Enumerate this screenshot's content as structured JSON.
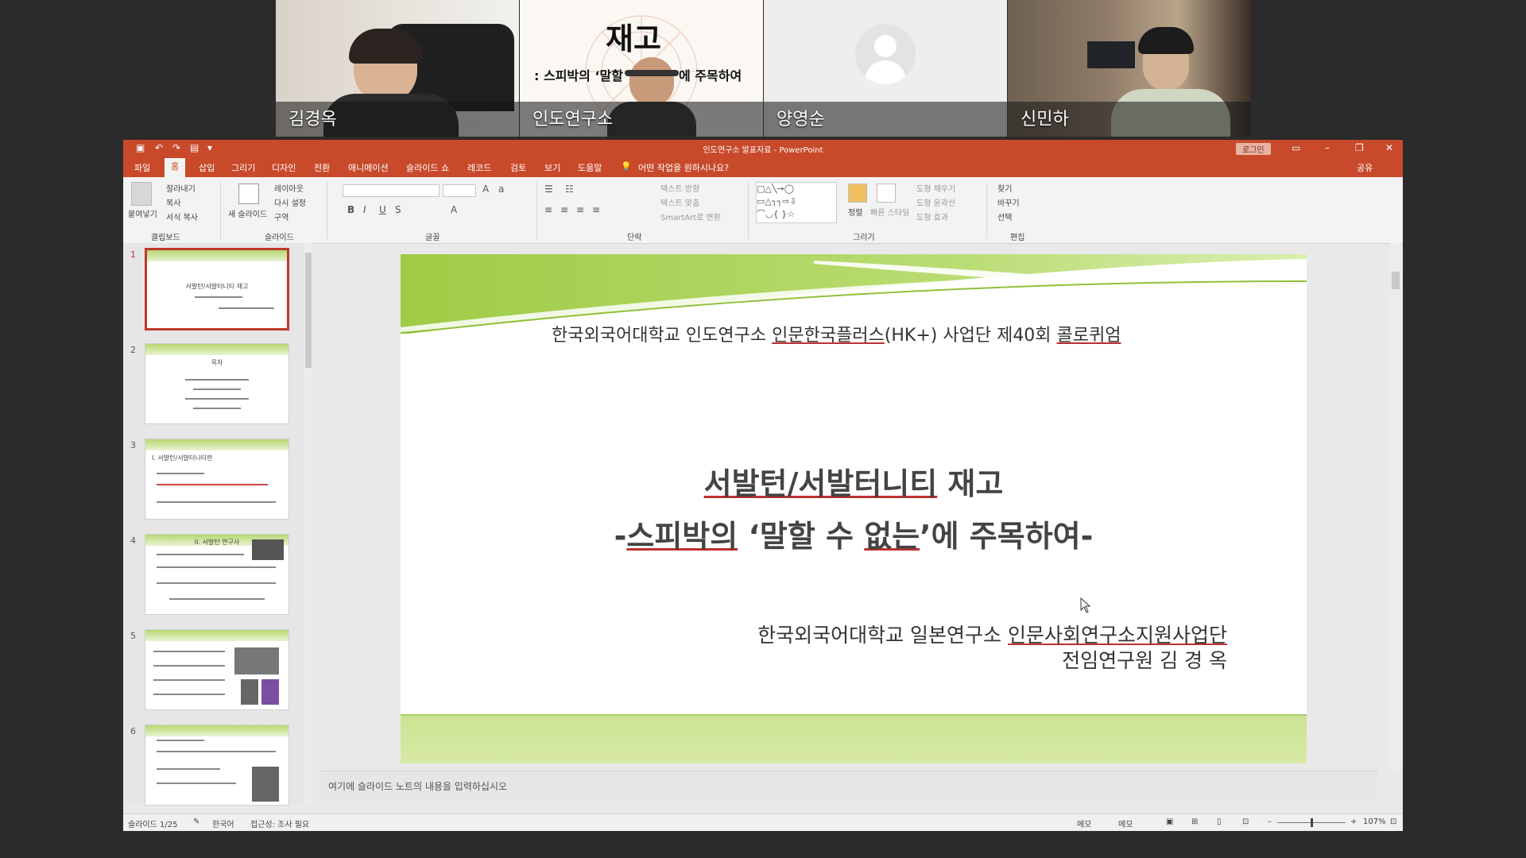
{
  "participants": [
    {
      "name": "김경옥"
    },
    {
      "name": "인도연구소",
      "shared_slide": {
        "title": "재고",
        "subtitle": ": 스피박의 ‘말할",
        "subtitle2": "에 주목하여"
      }
    },
    {
      "name": "양영순"
    },
    {
      "name": "신민하"
    }
  ],
  "window": {
    "title": "인도연구소 발표자료 - PowerPoint",
    "login_label": "로그인",
    "share_label": "공유",
    "tell_me": "어떤 작업을 원하시나요?"
  },
  "tabs": [
    "파일",
    "홈",
    "삽입",
    "그리기",
    "디자인",
    "전환",
    "애니메이션",
    "슬라이드 쇼",
    "레코드",
    "검토",
    "보기",
    "도움말"
  ],
  "ribbon": {
    "clipboard": {
      "paste": "붙여넣기",
      "cut": "잘라내기",
      "copy": "복사",
      "format_painter": "서식 복사",
      "group": "클립보드"
    },
    "slides": {
      "new_slide": "새 슬라이드",
      "layout": "레이아웃",
      "reset": "다시 설정",
      "section": "구역",
      "group": "슬라이드"
    },
    "font": {
      "group": "글꼴"
    },
    "paragraph": {
      "text_direction": "텍스트 방향",
      "align_text": "텍스트 맞춤",
      "smartart": "SmartArt로 변환",
      "group": "단락"
    },
    "drawing": {
      "arrange": "정렬",
      "quick_styles": "빠른 스타일",
      "shape_fill": "도형 채우기",
      "shape_outline": "도형 윤곽선",
      "shape_effects": "도형 효과",
      "group": "그리기"
    },
    "editing": {
      "find": "찾기",
      "replace": "바꾸기",
      "select": "선택",
      "group": "편집"
    }
  },
  "thumbnails": [
    {
      "num": "1",
      "title": "서발턴/서발터니티 재고"
    },
    {
      "num": "2",
      "title": "목차"
    },
    {
      "num": "3",
      "title": "I. 서발턴/서발터니티란"
    },
    {
      "num": "4",
      "title": "II. 서발턴 연구사"
    },
    {
      "num": "5",
      "title": ""
    },
    {
      "num": "6",
      "title": ""
    }
  ],
  "slide": {
    "header_pre": "한국외국어대학교 인도연구소 ",
    "header_u1": "인문한국플러스",
    "header_mid": "(HK+) 사업단 제40회 ",
    "header_u2": "콜로퀴엄",
    "title1_u": "서발턴/서발터니티",
    "title1_rest": " 재고",
    "title2_pre": "-",
    "title2_u1": "스피박의",
    "title2_mid": " ‘말할 수 ",
    "title2_u2": "없는",
    "title2_rest": "’에 주목하여-",
    "aff_pre": "한국외국어대학교 일본연구소 ",
    "aff_u": "인문사회연구소지원사업단",
    "name": "전임연구원 김   경   옥"
  },
  "notes_placeholder": "여기에 슬라이드 노트의 내용을 입력하십시오",
  "status": {
    "slide_counter": "슬라이드 1/25",
    "language": "한국어",
    "accessibility": "접근성: 조사 필요",
    "notes": "메모",
    "comments": "메모",
    "zoom": "107%"
  },
  "colors": {
    "accent": "#c84a2b",
    "slide_green": "#b8d870"
  }
}
